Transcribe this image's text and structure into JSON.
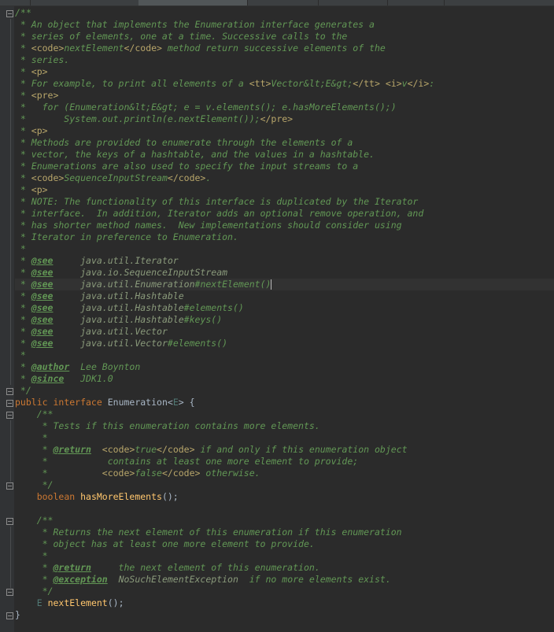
{
  "tabs": [
    "",
    "",
    "",
    "",
    "",
    "",
    ""
  ],
  "code": {
    "l1": "/**",
    "l2": " * An object that implements the Enumeration interface generates a",
    "l3": " * series of elements, one at a time. Successive calls to the",
    "l4a": " * ",
    "l4b": "<code>",
    "l4c": "nextElement",
    "l4d": "</code>",
    "l4e": " method return successive elements of the",
    "l5": " * series.",
    "l6a": " * ",
    "l6b": "<p>",
    "l7a": " * For example, to print all elements of a ",
    "l7b": "<tt>",
    "l7c": "Vector&lt;E&gt;",
    "l7d": "</tt>",
    "l7e": " ",
    "l7f": "<i>",
    "l7g": "v",
    "l7h": "</i>",
    "l7i": ":",
    "l8a": " * ",
    "l8b": "<pre>",
    "l9": " *   for (Enumeration&lt;E&gt; e = v.elements(); e.hasMoreElements();)",
    "l10a": " *       System.out.println(e.nextElement());",
    "l10b": "</pre>",
    "l11a": " * ",
    "l11b": "<p>",
    "l12": " * Methods are provided to enumerate through the elements of a",
    "l13": " * vector, the keys of a hashtable, and the values in a hashtable.",
    "l14": " * Enumerations are also used to specify the input streams to a",
    "l15a": " * ",
    "l15b": "<code>",
    "l15c": "SequenceInputStream",
    "l15d": "</code>",
    "l15e": ".",
    "l16a": " * ",
    "l16b": "<p>",
    "l17": " * NOTE: The functionality of this interface is duplicated by the Iterator",
    "l18": " * interface.  In addition, Iterator adds an optional remove operation, and",
    "l19": " * has shorter method names.  New implementations should consider using",
    "l20": " * Iterator in preference to Enumeration.",
    "l21": " *",
    "see": "@see",
    "star": " * ",
    "see_pad": "     ",
    "s1": "java.util.Iterator",
    "s2": "java.io.SequenceInputStream",
    "s3a": "java.util.Enumeration",
    "s3b": "#nextElement()",
    "s4": "java.util.Hashtable",
    "s5a": "java.util.Hashtable",
    "s5b": "#elements()",
    "s6a": "java.util.Hashtable",
    "s6b": "#keys()",
    "s7": "java.util.Vector",
    "s8a": "java.util.Vector",
    "s8b": "#elements()",
    "l30": " *",
    "author_tag": "@author",
    "author_val": "  Lee Boynton",
    "since_tag": "@since",
    "since_val": "   JDK1.0",
    "l33": " */",
    "l34a": "public ",
    "l34b": "interface ",
    "l34c": "Enumeration",
    "l34d": "<",
    "l34e": "E",
    "l34f": "> {",
    "l35": "    /**",
    "l36": "     * Tests if this enumeration contains more elements.",
    "l37": "     *",
    "l38a": "     * ",
    "l38b": "@return",
    "l38c": "  ",
    "l38d": "<code>",
    "l38e": "true",
    "l38f": "</code>",
    "l38g": " if and only if this enumeration object",
    "l39": "     *           contains at least one more element to provide;",
    "l40a": "     *          ",
    "l40b": "<code>",
    "l40c": "false",
    "l40d": "</code>",
    "l40e": " otherwise.",
    "l41": "     */",
    "l42a": "    ",
    "l42b": "boolean ",
    "l42c": "hasMoreElements",
    "l42d": "();",
    "l43": "",
    "l44": "    /**",
    "l45": "     * Returns the next element of this enumeration if this enumeration",
    "l46": "     * object has at least one more element to provide.",
    "l47": "     *",
    "l48a": "     * ",
    "l48b": "@return",
    "l48c": "     the next element of this enumeration.",
    "l49a": "     * ",
    "l49b": "@exception",
    "l49c": "  NoSuchElementException",
    "l49d": "  if no more elements exist.",
    "l50": "     */",
    "l51a": "    ",
    "l51b": "E ",
    "l51c": "nextElement",
    "l51d": "();",
    "l52": "}"
  }
}
